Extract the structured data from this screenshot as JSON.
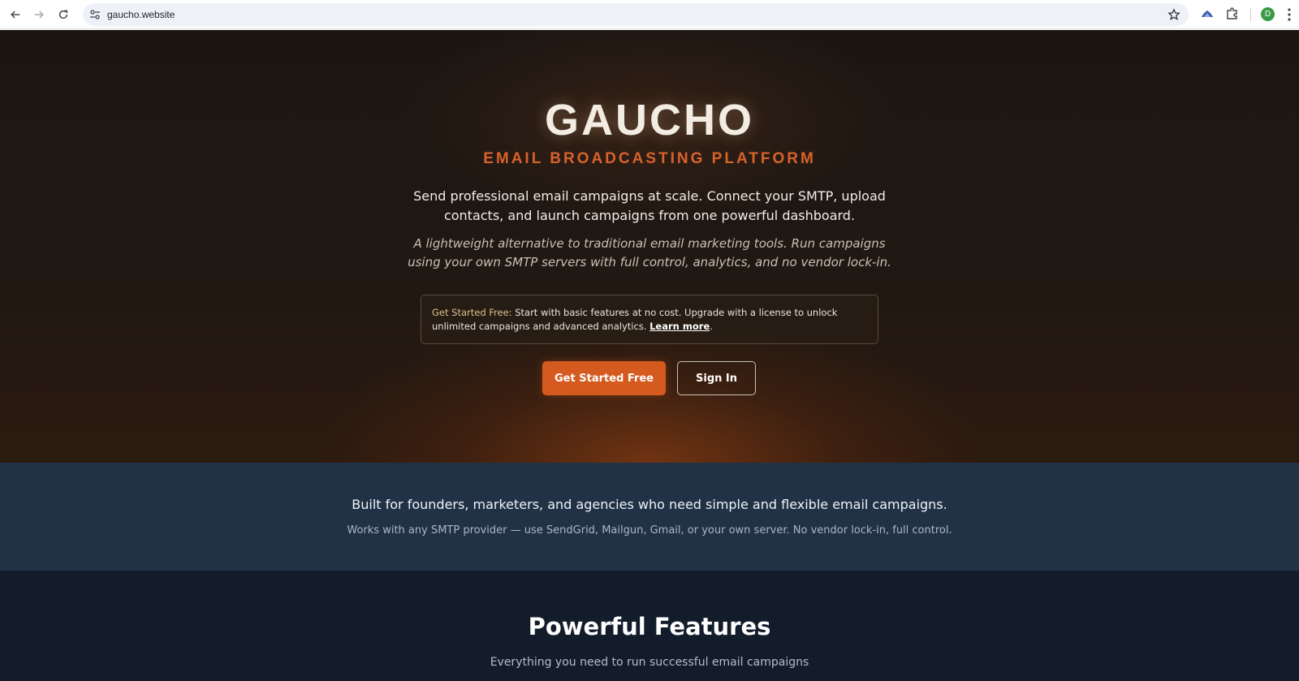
{
  "browser": {
    "url": "gaucho.website",
    "avatar_letter": "D"
  },
  "hero": {
    "logo": "GAUCHO",
    "tagline": "EMAIL BROADCASTING PLATFORM",
    "lead": "Send professional email campaigns at scale. Connect your SMTP, upload contacts, and launch campaigns from one powerful dashboard.",
    "sublead": "A lightweight alternative to traditional email marketing tools. Run campaigns using your own SMTP servers with full control, analytics, and no vendor lock-in.",
    "notice": {
      "label": "Get Started Free:",
      "text": " Start with basic features at no cost. Upgrade with a license to unlock unlimited campaigns and advanced analytics. ",
      "link": "Learn more",
      "trail": "."
    },
    "primary_button": "Get Started Free",
    "secondary_button": "Sign In"
  },
  "audience": {
    "title": "Built for founders, marketers, and agencies who need simple and flexible email campaigns.",
    "subtitle": "Works with any SMTP provider — use SendGrid, Mailgun, Gmail, or your own server. No vendor lock-in, full control."
  },
  "features": {
    "title": "Powerful Features",
    "subtitle": "Everything you need to run successful email campaigns"
  },
  "colors": {
    "accent": "#d55a1f",
    "hero_bg": "#1c1612",
    "audience_bg": "#223246",
    "features_bg": "#131c2b"
  }
}
